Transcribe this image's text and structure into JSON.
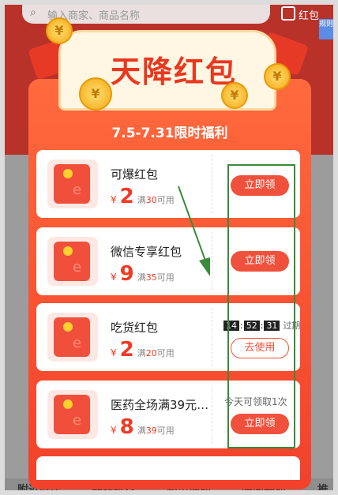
{
  "background": {
    "search_placeholder": "输入商家、商品名称",
    "right_label": "红包",
    "badge_text": "规则",
    "tabs": [
      "附近好店",
      "品牌推荐",
      "超市便利",
      "晚间福利",
      "推"
    ]
  },
  "popup": {
    "title": "天降红包",
    "subtitle": "7.5-7.31限时福利",
    "coupons": [
      {
        "name": "可爆红包",
        "currency": "¥",
        "amount": "2",
        "cond_prefix": "满",
        "threshold": "30",
        "cond_suffix": "可用",
        "action": "立即领",
        "style": "fill"
      },
      {
        "name": "微信专享红包",
        "currency": "¥",
        "amount": "9",
        "cond_prefix": "满",
        "threshold": "35",
        "cond_suffix": "可用",
        "action": "立即领",
        "style": "fill"
      },
      {
        "name": "吃货红包",
        "currency": "¥",
        "amount": "2",
        "cond_prefix": "满",
        "threshold": "20",
        "cond_suffix": "可用",
        "action": "去使用",
        "style": "line",
        "timer": [
          "14",
          "52",
          "31"
        ],
        "timer_label": "过期"
      },
      {
        "name": "医药全场满39元…",
        "currency": "¥",
        "amount": "8",
        "cond_prefix": "满",
        "threshold": "39",
        "cond_suffix": "可用",
        "action": "立即领",
        "style": "fill",
        "limit_note": "今天可领取1次"
      }
    ]
  },
  "colors": {
    "accent": "#f0513c",
    "annotation": "#3a8a3a"
  }
}
